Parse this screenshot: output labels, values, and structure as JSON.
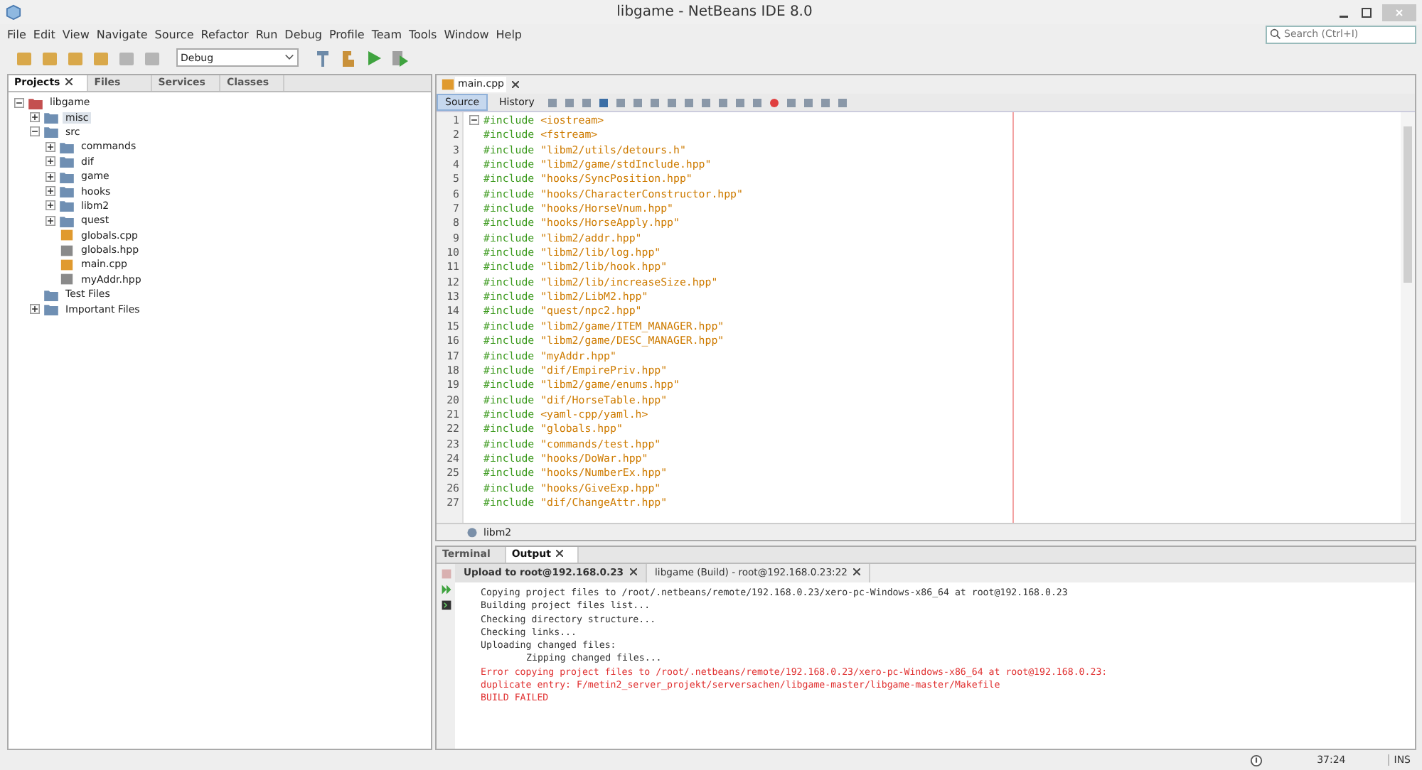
{
  "window": {
    "title": "libgame - NetBeans IDE 8.0"
  },
  "menu": [
    "File",
    "Edit",
    "View",
    "Navigate",
    "Source",
    "Refactor",
    "Run",
    "Debug",
    "Profile",
    "Team",
    "Tools",
    "Window",
    "Help"
  ],
  "search": {
    "placeholder": "Search (Ctrl+I)"
  },
  "toolbar": {
    "configuration": "Debug"
  },
  "side_tabs": [
    {
      "label": "Projects",
      "selected": true,
      "closable": true
    },
    {
      "label": "Files",
      "selected": false,
      "closable": false
    },
    {
      "label": "Services",
      "selected": false,
      "closable": false
    },
    {
      "label": "Classes",
      "selected": false,
      "closable": false
    }
  ],
  "tree": [
    {
      "label": "libgame",
      "kind": "project",
      "expanded": true,
      "selected": false,
      "children": [
        {
          "label": "misc",
          "kind": "folder",
          "expanded": false,
          "selected": true
        },
        {
          "label": "src",
          "kind": "folder",
          "expanded": true,
          "selected": false,
          "children": [
            {
              "label": "commands",
              "kind": "folder",
              "expanded": false,
              "selected": false
            },
            {
              "label": "dif",
              "kind": "folder",
              "expanded": false,
              "selected": false
            },
            {
              "label": "game",
              "kind": "folder",
              "expanded": false,
              "selected": false
            },
            {
              "label": "hooks",
              "kind": "folder",
              "expanded": false,
              "selected": false
            },
            {
              "label": "libm2",
              "kind": "folder",
              "expanded": false,
              "selected": false
            },
            {
              "label": "quest",
              "kind": "folder",
              "expanded": false,
              "selected": false
            },
            {
              "label": "globals.cpp",
              "kind": "cpp",
              "selected": false
            },
            {
              "label": "globals.hpp",
              "kind": "hpp",
              "selected": false
            },
            {
              "label": "main.cpp",
              "kind": "cpp",
              "selected": false
            },
            {
              "label": "myAddr.hpp",
              "kind": "hpp",
              "selected": false
            }
          ]
        },
        {
          "label": "Test Files",
          "kind": "folder",
          "selected": false
        },
        {
          "label": "Important Files",
          "kind": "folder",
          "expanded": false,
          "selected": false
        }
      ]
    }
  ],
  "editor": {
    "file_tab": "main.cpp",
    "view_tabs": [
      {
        "label": "Source",
        "selected": true
      },
      {
        "label": "History",
        "selected": false
      }
    ],
    "lines": [
      {
        "n": "1",
        "kw": "#include",
        "arg": "<iostream>"
      },
      {
        "n": "2",
        "kw": "#include",
        "arg": "<fstream>"
      },
      {
        "n": "3",
        "kw": "#include",
        "arg": "\"libm2/utils/detours.h\""
      },
      {
        "n": "4",
        "kw": "#include",
        "arg": "\"libm2/game/stdInclude.hpp\""
      },
      {
        "n": "5",
        "kw": "#include",
        "arg": "\"hooks/SyncPosition.hpp\""
      },
      {
        "n": "6",
        "kw": "#include",
        "arg": "\"hooks/CharacterConstructor.hpp\""
      },
      {
        "n": "7",
        "kw": "#include",
        "arg": "\"hooks/HorseVnum.hpp\""
      },
      {
        "n": "8",
        "kw": "#include",
        "arg": "\"hooks/HorseApply.hpp\""
      },
      {
        "n": "9",
        "kw": "#include",
        "arg": "\"libm2/addr.hpp\""
      },
      {
        "n": "10",
        "kw": "#include",
        "arg": "\"libm2/lib/log.hpp\""
      },
      {
        "n": "11",
        "kw": "#include",
        "arg": "\"libm2/lib/hook.hpp\""
      },
      {
        "n": "12",
        "kw": "#include",
        "arg": "\"libm2/lib/increaseSize.hpp\""
      },
      {
        "n": "13",
        "kw": "#include",
        "arg": "\"libm2/LibM2.hpp\""
      },
      {
        "n": "14",
        "kw": "#include",
        "arg": "\"quest/npc2.hpp\""
      },
      {
        "n": "15",
        "kw": "#include",
        "arg": "\"libm2/game/ITEM_MANAGER.hpp\""
      },
      {
        "n": "16",
        "kw": "#include",
        "arg": "\"libm2/game/DESC_MANAGER.hpp\""
      },
      {
        "n": "17",
        "kw": "#include",
        "arg": "\"myAddr.hpp\""
      },
      {
        "n": "18",
        "kw": "#include",
        "arg": "\"dif/EmpirePriv.hpp\""
      },
      {
        "n": "19",
        "kw": "#include",
        "arg": "\"libm2/game/enums.hpp\""
      },
      {
        "n": "20",
        "kw": "#include",
        "arg": "\"dif/HorseTable.hpp\""
      },
      {
        "n": "21",
        "kw": "#include",
        "arg": "<yaml-cpp/yaml.h>"
      },
      {
        "n": "22",
        "kw": "#include",
        "arg": "\"globals.hpp\""
      },
      {
        "n": "23",
        "kw": "#include",
        "arg": "\"commands/test.hpp\""
      },
      {
        "n": "24",
        "kw": "#include",
        "arg": "\"hooks/DoWar.hpp\""
      },
      {
        "n": "25",
        "kw": "#include",
        "arg": "\"hooks/NumberEx.hpp\""
      },
      {
        "n": "26",
        "kw": "#include",
        "arg": "\"hooks/GiveExp.hpp\""
      },
      {
        "n": "27",
        "kw": "#include",
        "arg": "\"dif/ChangeAttr.hpp\""
      }
    ],
    "breadcrumb": "libm2"
  },
  "bottom_tabs": [
    {
      "label": "Terminal",
      "selected": false,
      "closable": false
    },
    {
      "label": "Output",
      "selected": true,
      "closable": true
    }
  ],
  "output_tabs": [
    {
      "label": "Upload to root@192.168.0.23",
      "selected": true
    },
    {
      "label": "libgame (Build) - root@192.168.0.23:22",
      "selected": false
    }
  ],
  "output": [
    {
      "text": "Copying project files to /root/.netbeans/remote/192.168.0.23/xero-pc-Windows-x86_64 at root@192.168.0.23",
      "kind": "info"
    },
    {
      "text": "Building project files list...",
      "kind": "info"
    },
    {
      "text": "Checking directory structure...",
      "kind": "info"
    },
    {
      "text": "Checking links...",
      "kind": "info"
    },
    {
      "text": "Uploading changed files:",
      "kind": "info"
    },
    {
      "text": "Zipping changed files...",
      "kind": "sub"
    },
    {
      "text": "Error copying project files to /root/.netbeans/remote/192.168.0.23/xero-pc-Windows-x86_64 at root@192.168.0.23:",
      "kind": "error"
    },
    {
      "text": "duplicate entry: F/metin2_server_projekt/serversachen/libgame-master/libgame-master/Makefile",
      "kind": "error"
    },
    {
      "text": "BUILD FAILED",
      "kind": "error"
    }
  ],
  "status_bar": {
    "position": "37:24",
    "mode": "INS"
  }
}
